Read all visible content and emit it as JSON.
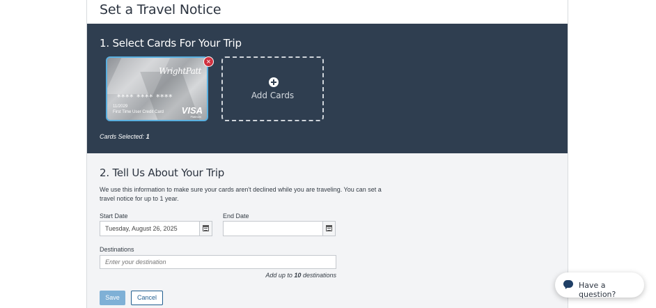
{
  "page": {
    "title": "Set a Travel Notice"
  },
  "section1": {
    "title": "1. Select Cards For Your Trip",
    "card": {
      "brand": "WrightPatt",
      "number": "**** **** ****",
      "expiry": "11/2029",
      "name": "First Time User Credit Card",
      "network": "VISA",
      "network_sub": "Platinum"
    },
    "remove_label": "×",
    "add_cards_label": "Add Cards",
    "cards_selected_label": "Cards Selected:",
    "cards_selected_count": "1"
  },
  "section2": {
    "title": "2. Tell Us About Your Trip",
    "description": "We use this information to make sure your cards aren't declined while you are traveling. You can set a travel notice for up to 1 year.",
    "start_date_label": "Start Date",
    "start_date_value": "Tuesday, August 26, 2025",
    "end_date_label": "End Date",
    "end_date_value": "",
    "destinations_label": "Destinations",
    "destinations_placeholder": "Enter your destination",
    "hint_prefix": "Add up to",
    "hint_count": "10",
    "hint_suffix": "destinations",
    "save_label": "Save",
    "cancel_label": "Cancel"
  },
  "chat": {
    "label": "Have a question?"
  },
  "colors": {
    "header_bg": "#2f3e50",
    "save_bg": "#7fb0d6",
    "cancel_border": "#1f5d8f",
    "remove_red": "#d0313f",
    "card_outline": "#5ab0e0"
  },
  "icons": [
    "close-icon",
    "plus-circle-icon",
    "calendar-icon",
    "chat-bubble-icon"
  ]
}
